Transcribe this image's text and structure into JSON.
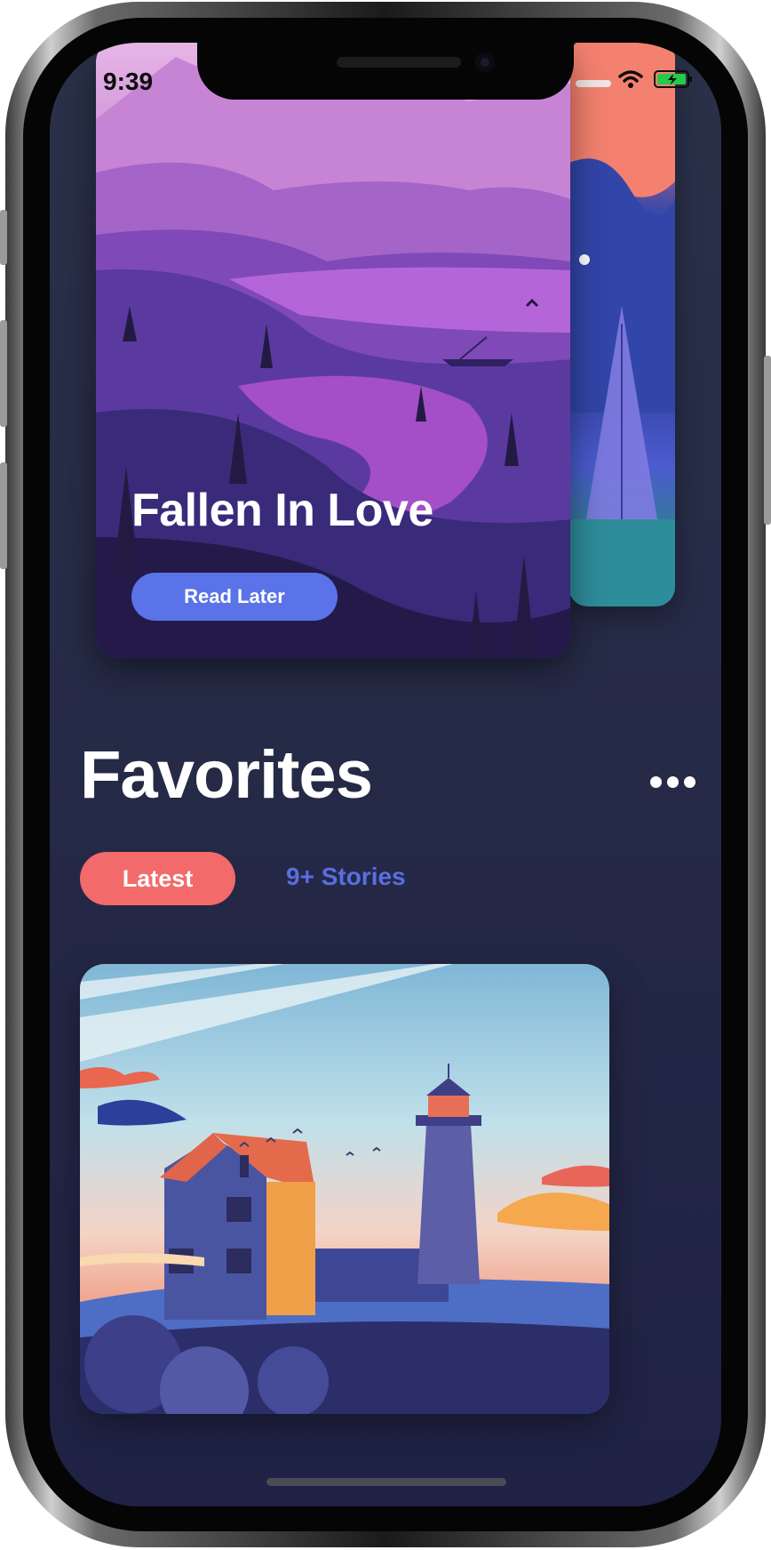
{
  "status_bar": {
    "time": "9:39"
  },
  "featured": {
    "title": "Fallen In Love",
    "button_label": "Read Later"
  },
  "favorites": {
    "heading": "Favorites",
    "tabs": {
      "latest": "Latest",
      "stories": "9+ Stories"
    }
  },
  "colors": {
    "background": "#242a48",
    "accent_blue": "#5b73e8",
    "accent_coral": "#f26a6a",
    "link_blue": "#5a6ee0"
  }
}
